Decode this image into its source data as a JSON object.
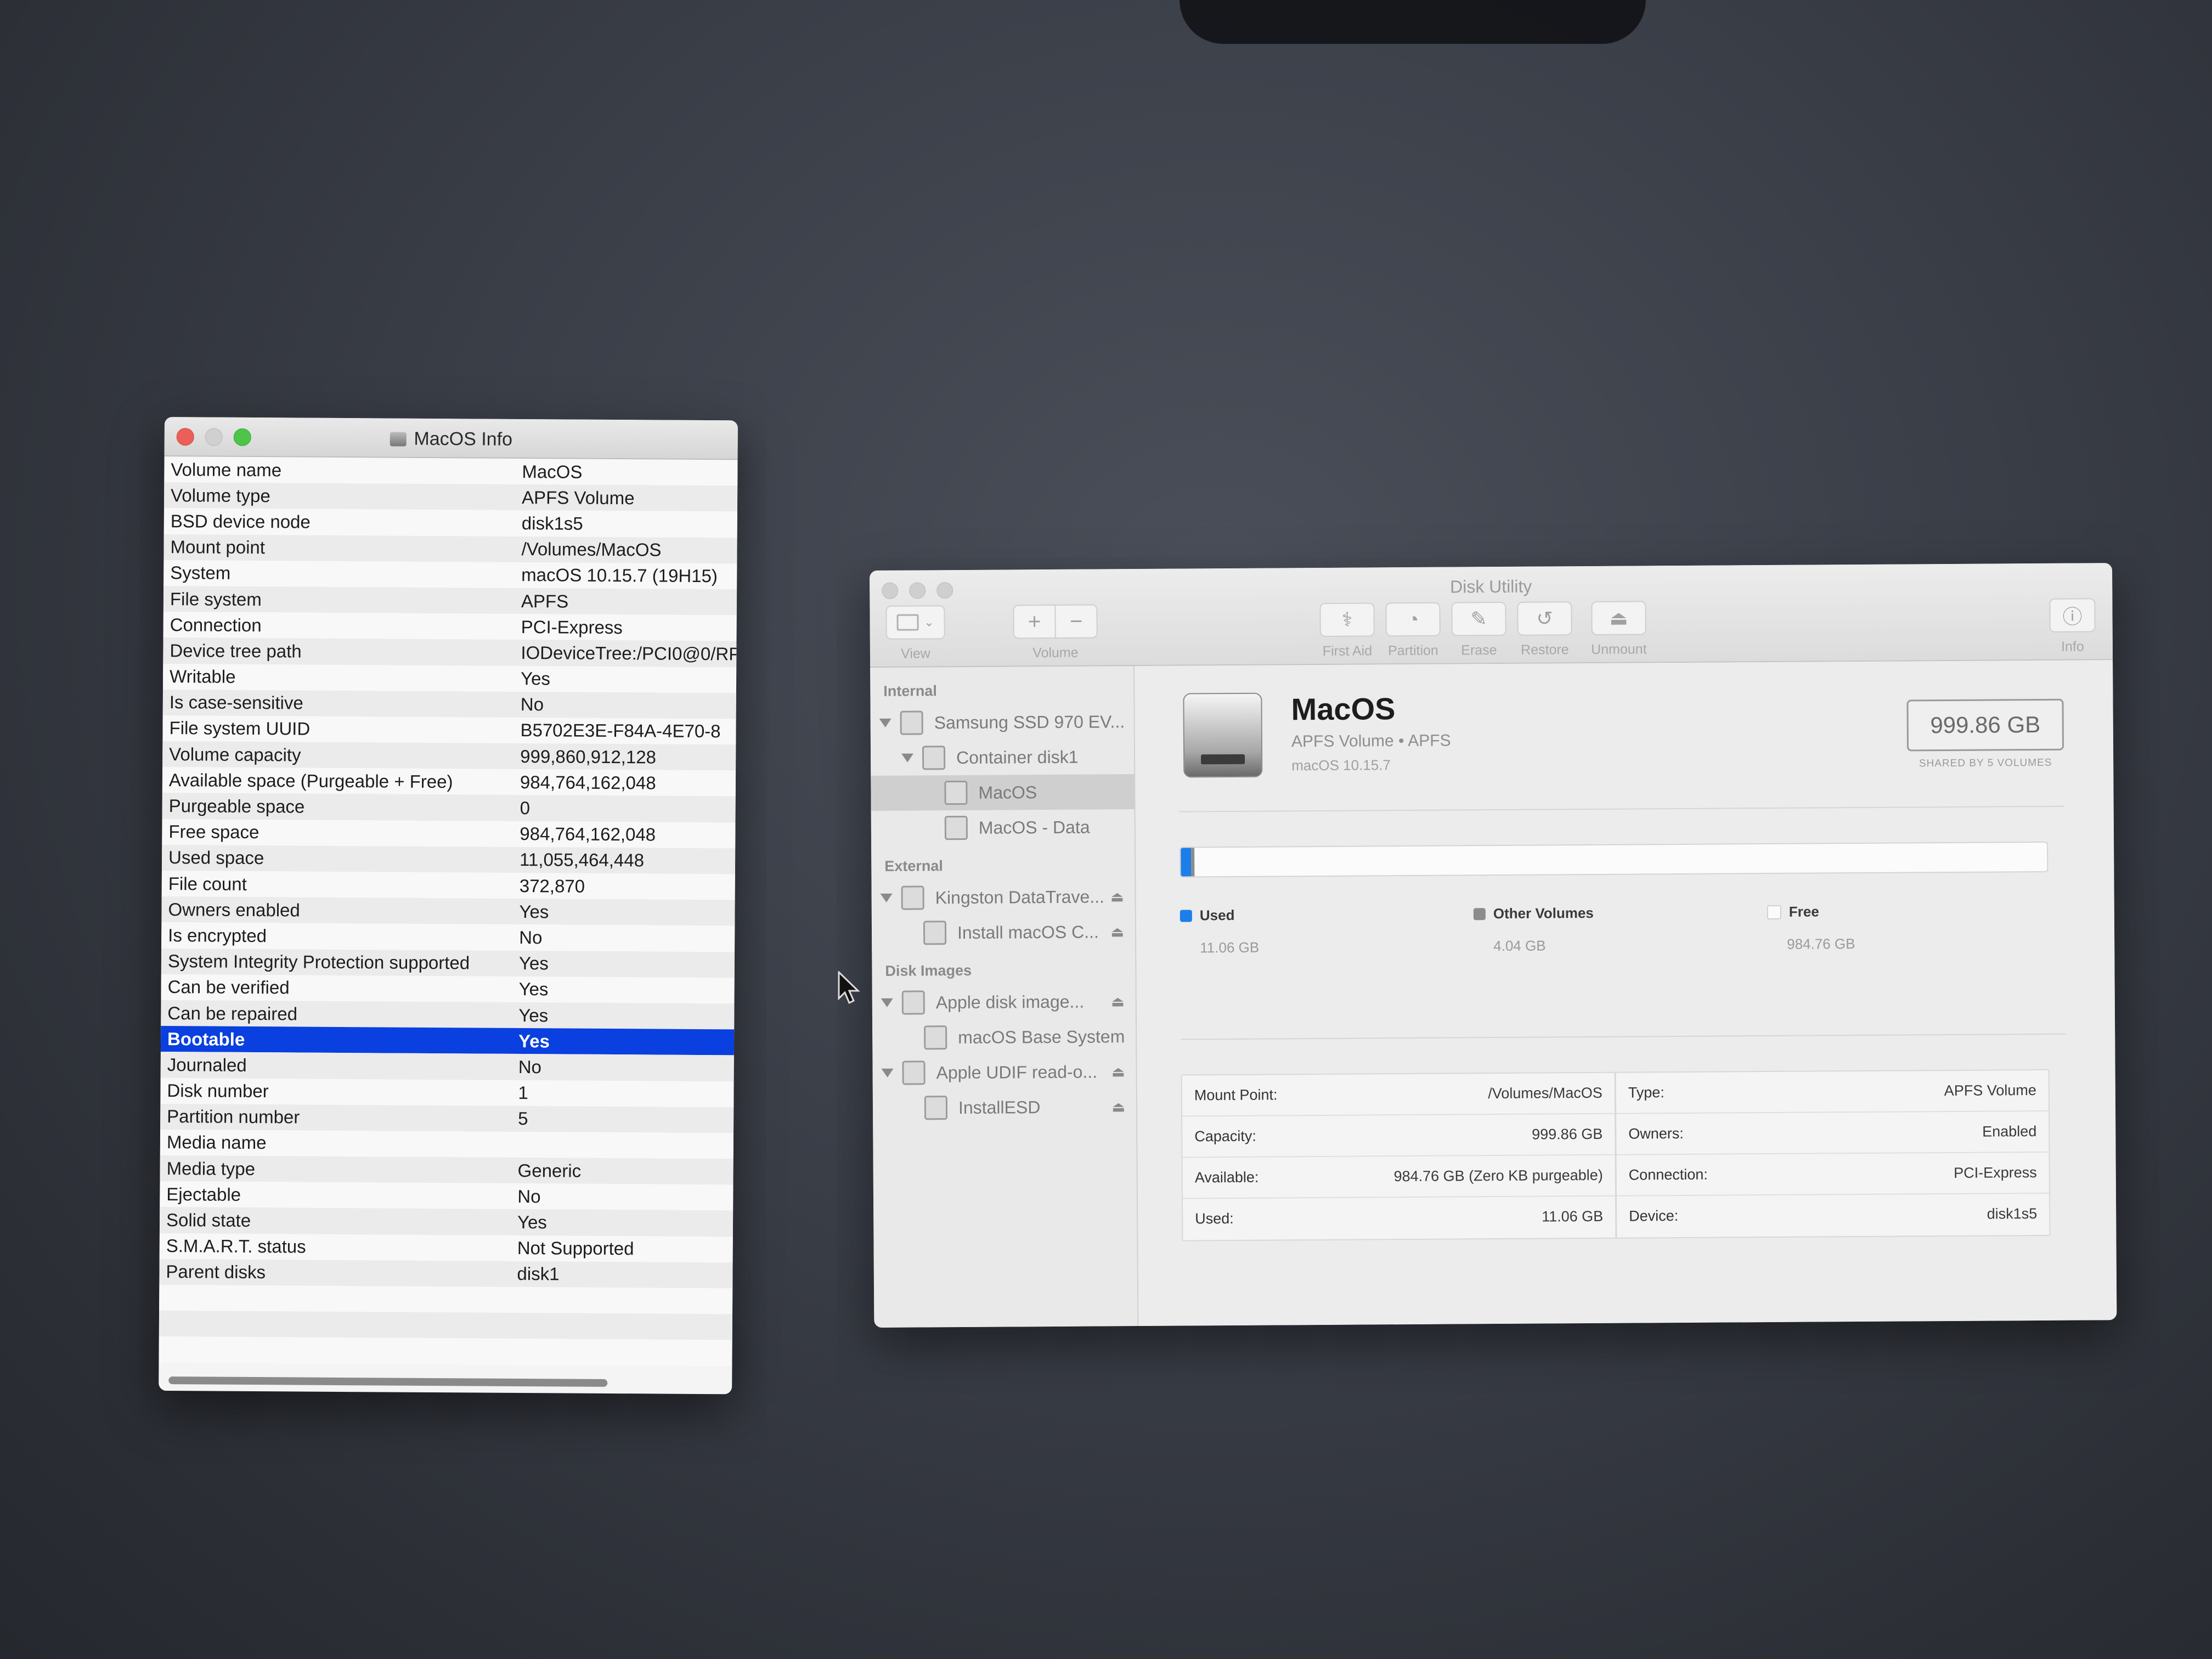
{
  "info_window": {
    "title": "MacOS Info",
    "rows": [
      {
        "key": "Volume name",
        "value": "MacOS"
      },
      {
        "key": "Volume type",
        "value": "APFS Volume"
      },
      {
        "key": "BSD device node",
        "value": "disk1s5"
      },
      {
        "key": "Mount point",
        "value": "/Volumes/MacOS"
      },
      {
        "key": "System",
        "value": "macOS 10.15.7 (19H15)"
      },
      {
        "key": "File system",
        "value": "APFS"
      },
      {
        "key": "Connection",
        "value": "PCI-Express"
      },
      {
        "key": "Device tree path",
        "value": "IODeviceTree:/PCI0@0/RP"
      },
      {
        "key": "Writable",
        "value": "Yes"
      },
      {
        "key": "Is case-sensitive",
        "value": "No"
      },
      {
        "key": "File system UUID",
        "value": "B5702E3E-F84A-4E70-8"
      },
      {
        "key": "Volume capacity",
        "value": "999,860,912,128"
      },
      {
        "key": "Available space (Purgeable + Free)",
        "value": "984,764,162,048"
      },
      {
        "key": "Purgeable space",
        "value": "0"
      },
      {
        "key": "Free space",
        "value": "984,764,162,048"
      },
      {
        "key": "Used space",
        "value": "11,055,464,448"
      },
      {
        "key": "File count",
        "value": "372,870"
      },
      {
        "key": "Owners enabled",
        "value": "Yes"
      },
      {
        "key": "Is encrypted",
        "value": "No"
      },
      {
        "key": "System Integrity Protection supported",
        "value": "Yes"
      },
      {
        "key": "Can be verified",
        "value": "Yes"
      },
      {
        "key": "Can be repaired",
        "value": "Yes"
      },
      {
        "key": "Bootable",
        "value": "Yes"
      },
      {
        "key": "Journaled",
        "value": "No"
      },
      {
        "key": "Disk number",
        "value": "1"
      },
      {
        "key": "Partition number",
        "value": "5"
      },
      {
        "key": "Media name",
        "value": ""
      },
      {
        "key": "Media type",
        "value": "Generic"
      },
      {
        "key": "Ejectable",
        "value": "No"
      },
      {
        "key": "Solid state",
        "value": "Yes"
      },
      {
        "key": "S.M.A.R.T. status",
        "value": "Not Supported"
      },
      {
        "key": "Parent disks",
        "value": "disk1"
      }
    ],
    "selected_row_index": 22
  },
  "disk_utility": {
    "title": "Disk Utility",
    "toolbar": {
      "view_label": "View",
      "volume_label": "Volume",
      "volume_add": "+",
      "volume_remove": "−",
      "first_aid_label": "First Aid",
      "partition_label": "Partition",
      "erase_label": "Erase",
      "restore_label": "Restore",
      "unmount_label": "Unmount",
      "info_label": "Info"
    },
    "sidebar": {
      "internal_header": "Internal",
      "external_header": "External",
      "disk_images_header": "Disk Images",
      "items": {
        "samsung": "Samsung SSD 970 EV...",
        "container": "Container disk1",
        "macos": "MacOS",
        "macos_data": "MacOS - Data",
        "kingston": "Kingston DataTrave...",
        "install_macos": "Install macOS C...",
        "apple_disk_image": "Apple disk image...",
        "macos_base_system": "macOS Base System",
        "apple_udif": "Apple UDIF read-o...",
        "install_esd": "InstallESD"
      },
      "eject_glyph": "⏏"
    },
    "volume": {
      "name": "MacOS",
      "subtitle": "APFS Volume • APFS",
      "os_version": "macOS 10.15.7",
      "capacity": "999.86 GB",
      "shared_label": "SHARED BY 5 VOLUMES"
    },
    "usage": {
      "used_label": "Used",
      "used_value": "11.06 GB",
      "other_label": "Other Volumes",
      "other_value": "4.04 GB",
      "free_label": "Free",
      "free_value": "984.76 GB",
      "used_fraction": 0.0111,
      "other_fraction": 0.004,
      "used_color": "#1c7ee8",
      "other_color": "#8c8c8c",
      "free_color": "#fbfbfb"
    },
    "details_left": [
      {
        "label": "Mount Point:",
        "value": "/Volumes/MacOS"
      },
      {
        "label": "Capacity:",
        "value": "999.86 GB"
      },
      {
        "label": "Available:",
        "value": "984.76 GB (Zero KB purgeable)"
      },
      {
        "label": "Used:",
        "value": "11.06 GB"
      }
    ],
    "details_right": [
      {
        "label": "Type:",
        "value": "APFS Volume"
      },
      {
        "label": "Owners:",
        "value": "Enabled"
      },
      {
        "label": "Connection:",
        "value": "PCI-Express"
      },
      {
        "label": "Device:",
        "value": "disk1s5"
      }
    ]
  }
}
